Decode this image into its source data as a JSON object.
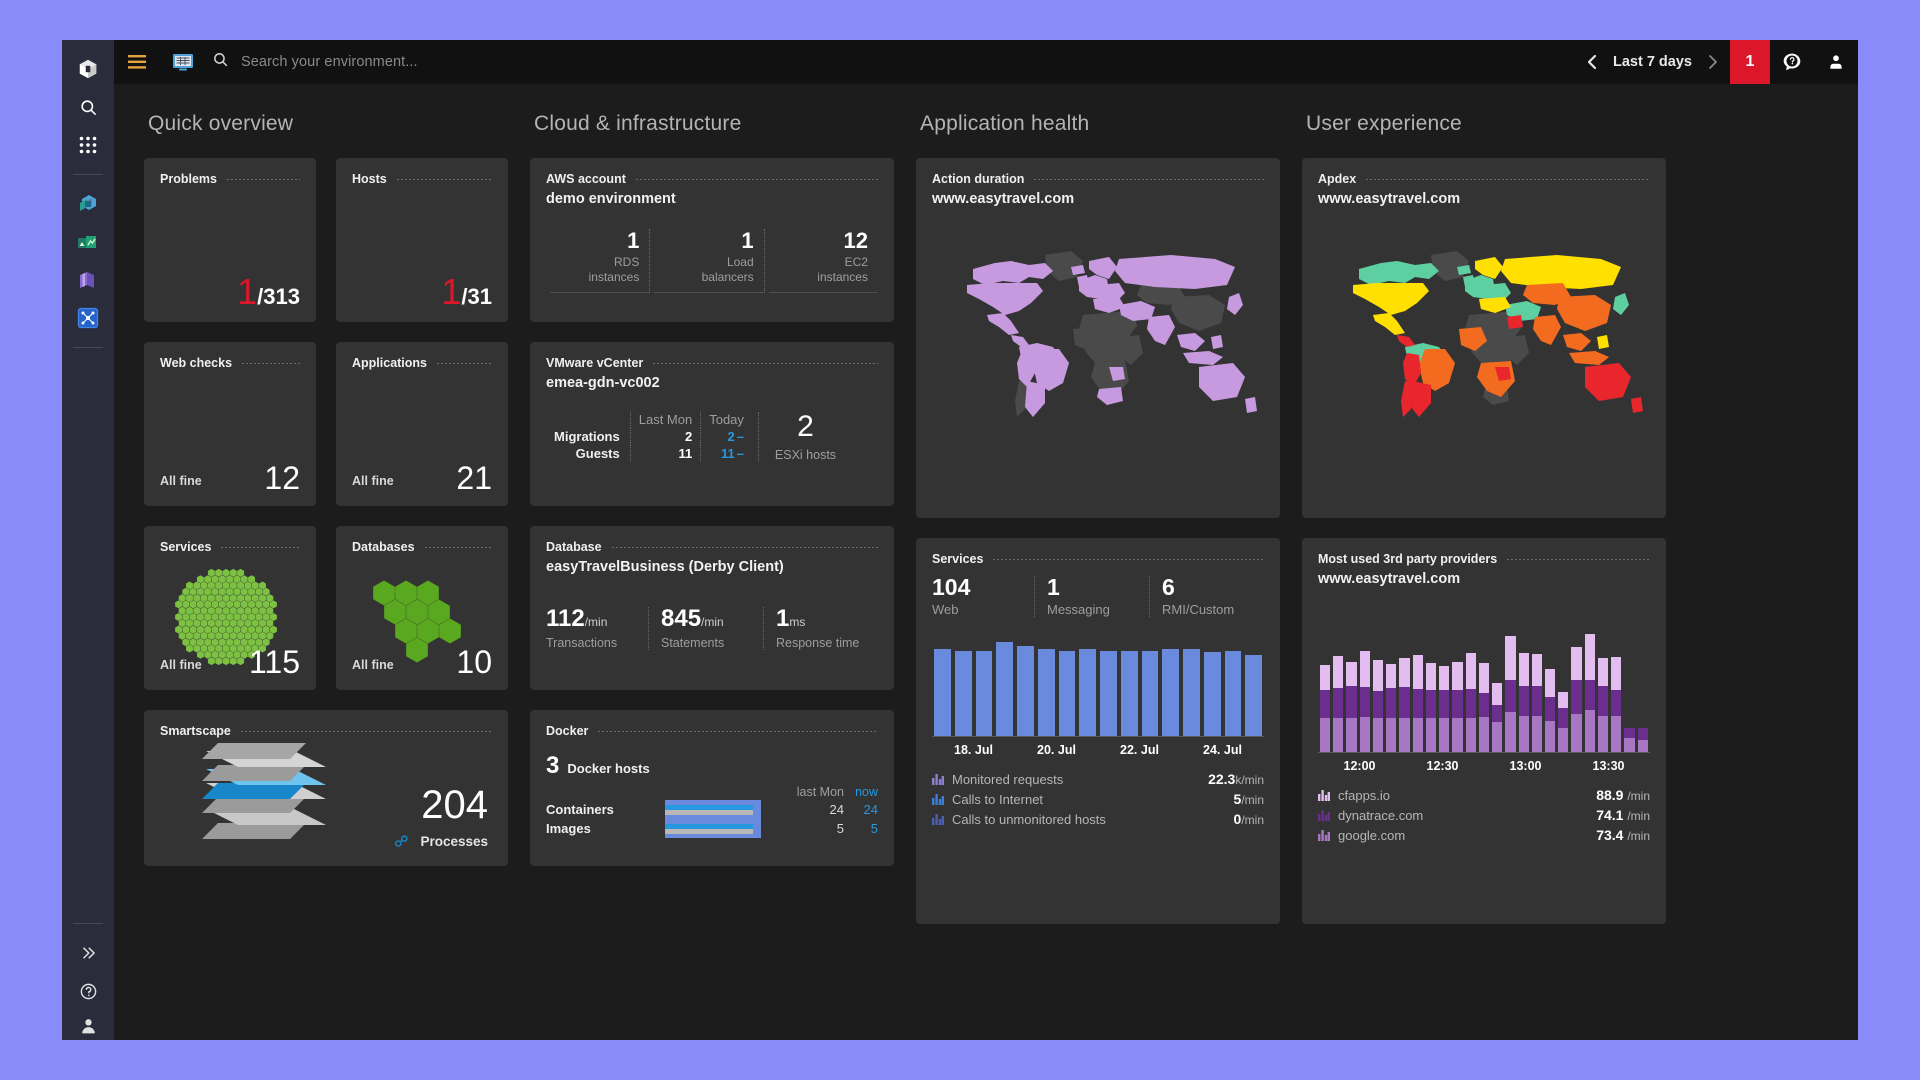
{
  "app": {
    "brand_icon": "cube-logo-icon"
  },
  "rail": {
    "items": [
      {
        "name": "dynatrace-logo-icon",
        "label": "Dynatrace"
      },
      {
        "name": "search-icon",
        "label": "Search"
      },
      {
        "name": "apps-grid-icon",
        "label": "Apps"
      },
      {
        "name": "applications-icon",
        "label": "Applications"
      },
      {
        "name": "transactions-services-icon",
        "label": "Transactions & services"
      },
      {
        "name": "hosts-icon",
        "label": "Hosts"
      },
      {
        "name": "smartscape-icon",
        "label": "Smartscape"
      }
    ],
    "bottom_items": [
      {
        "name": "expand-chevrons-icon",
        "label": "Expand"
      },
      {
        "name": "help-circle-icon",
        "label": "Help"
      },
      {
        "name": "user-account-icon",
        "label": "Account"
      }
    ]
  },
  "topbar": {
    "menu_icon": "hamburger-menu-icon",
    "dashboard_icon": "dashboard-icon",
    "search_icon": "search-icon",
    "search_placeholder": "Search your environment...",
    "timeframe": {
      "prev_icon": "chevron-left-icon",
      "label": "Last 7 days",
      "next_icon": "chevron-right-icon"
    },
    "alert_count": "1",
    "help_icon": "help-chat-icon",
    "user_icon": "user-avatar-icon"
  },
  "columns": [
    {
      "title": "Quick overview"
    },
    {
      "title": "Cloud & infrastructure"
    },
    {
      "title": "Application health"
    },
    {
      "title": "User experience"
    }
  ],
  "quick_overview": {
    "problems": {
      "title": "Problems",
      "bad": "1",
      "total": "/313"
    },
    "hosts": {
      "title": "Hosts",
      "bad": "1",
      "total": "/31"
    },
    "web_checks": {
      "title": "Web checks",
      "status": "All fine",
      "value": "12"
    },
    "applications": {
      "title": "Applications",
      "status": "All fine",
      "value": "21"
    },
    "services": {
      "title": "Services",
      "status": "All fine",
      "value": "115",
      "hex_color": "#7dc142"
    },
    "databases": {
      "title": "Databases",
      "status": "All fine",
      "value": "10",
      "hex_color": "#5aa81f"
    },
    "smartscape": {
      "title": "Smartscape",
      "value": "204",
      "caption": "Processes",
      "icon": "process-link-icon"
    }
  },
  "cloud": {
    "aws": {
      "title": "AWS account",
      "subtitle": "demo environment",
      "metrics": [
        {
          "value": "1",
          "caption": "RDS\ninstances"
        },
        {
          "value": "1",
          "caption": "Load\nbalancers"
        },
        {
          "value": "12",
          "caption": "EC2\ninstances"
        }
      ]
    },
    "vmware": {
      "title": "VMware vCenter",
      "subtitle": "emea-gdn-vc002",
      "col_last": "Last Mon",
      "col_today": "Today",
      "rows": [
        {
          "label": "Migrations",
          "last": "2",
          "today": "2",
          "trend": "–"
        },
        {
          "label": "Guests",
          "last": "11",
          "today": "11",
          "trend": "–"
        }
      ],
      "esxi_value": "2",
      "esxi_caption": "ESXi hosts"
    },
    "database": {
      "title": "Database",
      "subtitle": "easyTravelBusiness (Derby Client)",
      "metrics": [
        {
          "value": "112",
          "unit": "/min",
          "caption": "Transactions"
        },
        {
          "value": "845",
          "unit": "/min",
          "caption": "Statements"
        },
        {
          "value": "1",
          "unit": "ms",
          "caption": "Response time"
        }
      ]
    },
    "docker": {
      "title": "Docker",
      "hosts_value": "3",
      "hosts_caption": "Docker hosts",
      "col_last": "last Mon",
      "col_now": "now",
      "rows": [
        {
          "label": "Containers",
          "last": "24",
          "now": "24",
          "fill": 100
        },
        {
          "label": "Images",
          "last": "5",
          "now": "5",
          "fill": 100
        }
      ]
    }
  },
  "app_health": {
    "action_duration": {
      "title": "Action duration",
      "subtitle": "www.easytravel.com",
      "map_color": "#c79ae0",
      "map_inactive": "#4a4a4a"
    },
    "services": {
      "title": "Services",
      "metrics": [
        {
          "value": "104",
          "caption": "Web"
        },
        {
          "value": "1",
          "caption": "Messaging"
        },
        {
          "value": "6",
          "caption": "RMI/Custom"
        }
      ],
      "legend": [
        {
          "icon": "bar-chart-icon",
          "name": "Monitored requests",
          "value": "22.3",
          "unit": "k/min",
          "color": "#8e7fd0"
        },
        {
          "icon": "bar-chart-icon",
          "name": "Calls to Internet",
          "value": "5",
          "unit": "/min",
          "color": "#3d7ed8"
        },
        {
          "icon": "bar-chart-icon",
          "name": "Calls to unmonitored hosts",
          "value": "0",
          "unit": "/min",
          "color": "#4b5fb5"
        }
      ]
    }
  },
  "user_experience": {
    "apdex": {
      "title": "Apdex",
      "subtitle": "www.easytravel.com",
      "map_colors": {
        "good": "#5ecfa0",
        "fair": "#ffe000",
        "poor": "#f26b1f",
        "bad": "#e8262b",
        "inactive": "#4a4a4a"
      }
    },
    "third_party": {
      "title": "Most used 3rd party providers",
      "subtitle": "www.easytravel.com",
      "legend": [
        {
          "icon": "bar-chart-icon",
          "name": "cfapps.io",
          "value": "88.9",
          "unit": "/min",
          "color": "#e3bdf0"
        },
        {
          "icon": "bar-chart-icon",
          "name": "dynatrace.com",
          "value": "74.1",
          "unit": "/min",
          "color": "#6b2d8e"
        },
        {
          "icon": "bar-chart-icon",
          "name": "google.com",
          "value": "73.4",
          "unit": "/min",
          "color": "#a877c4"
        }
      ]
    }
  },
  "chart_data": [
    {
      "id": "services-requests",
      "type": "bar",
      "title": "Services",
      "xlabel": "",
      "ylabel": "",
      "grid": false,
      "legend_position": "below",
      "tick_labels": [
        "18. Jul",
        "20. Jul",
        "22. Jul",
        "24. Jul"
      ],
      "categories": [
        "1",
        "2",
        "3",
        "4",
        "5",
        "6",
        "7",
        "8",
        "9",
        "10",
        "11",
        "12",
        "13",
        "14",
        "15",
        "16"
      ],
      "values": [
        84,
        83,
        83,
        91,
        87,
        84,
        83,
        84,
        83,
        83,
        83,
        84,
        84,
        82,
        83,
        79
      ],
      "ylim": [
        0,
        100
      ],
      "series_color": "#6a8bdd",
      "legend": [
        {
          "name": "Monitored requests",
          "value": 22.3,
          "unit": "k/min"
        },
        {
          "name": "Calls to Internet",
          "value": 5,
          "unit": "/min"
        },
        {
          "name": "Calls to unmonitored hosts",
          "value": 0,
          "unit": "/min"
        }
      ]
    },
    {
      "id": "third-party-providers",
      "type": "bar",
      "stacked": true,
      "title": "Most used 3rd party providers",
      "xlabel": "",
      "ylabel": "",
      "grid": false,
      "legend_position": "below",
      "tick_labels": [
        "12:00",
        "12:30",
        "13:00",
        "13:30"
      ],
      "ylim": [
        0,
        100
      ],
      "series": [
        {
          "name": "google.com",
          "color": "#a877c4",
          "values": [
            34,
            34,
            34,
            35,
            34,
            34,
            34,
            34,
            34,
            34,
            34,
            34,
            35,
            30,
            40,
            36,
            36,
            31,
            24,
            38,
            42,
            36,
            36,
            14,
            12
          ]
        },
        {
          "name": "dynatrace.com",
          "color": "#6b2d8e",
          "values": [
            28,
            30,
            32,
            30,
            27,
            30,
            31,
            29,
            28,
            28,
            28,
            29,
            24,
            17,
            32,
            30,
            30,
            24,
            20,
            34,
            30,
            30,
            26,
            10,
            12
          ]
        },
        {
          "name": "cfapps.io",
          "color": "#e3bdf0",
          "values": [
            25,
            32,
            24,
            36,
            31,
            24,
            29,
            34,
            27,
            24,
            28,
            36,
            30,
            22,
            44,
            33,
            32,
            28,
            16,
            33,
            46,
            28,
            33,
            0,
            0
          ]
        }
      ],
      "legend": [
        {
          "name": "cfapps.io",
          "value": 88.9,
          "unit": "/min"
        },
        {
          "name": "dynatrace.com",
          "value": 74.1,
          "unit": "/min"
        },
        {
          "name": "google.com",
          "value": 73.4,
          "unit": "/min"
        }
      ]
    }
  ]
}
